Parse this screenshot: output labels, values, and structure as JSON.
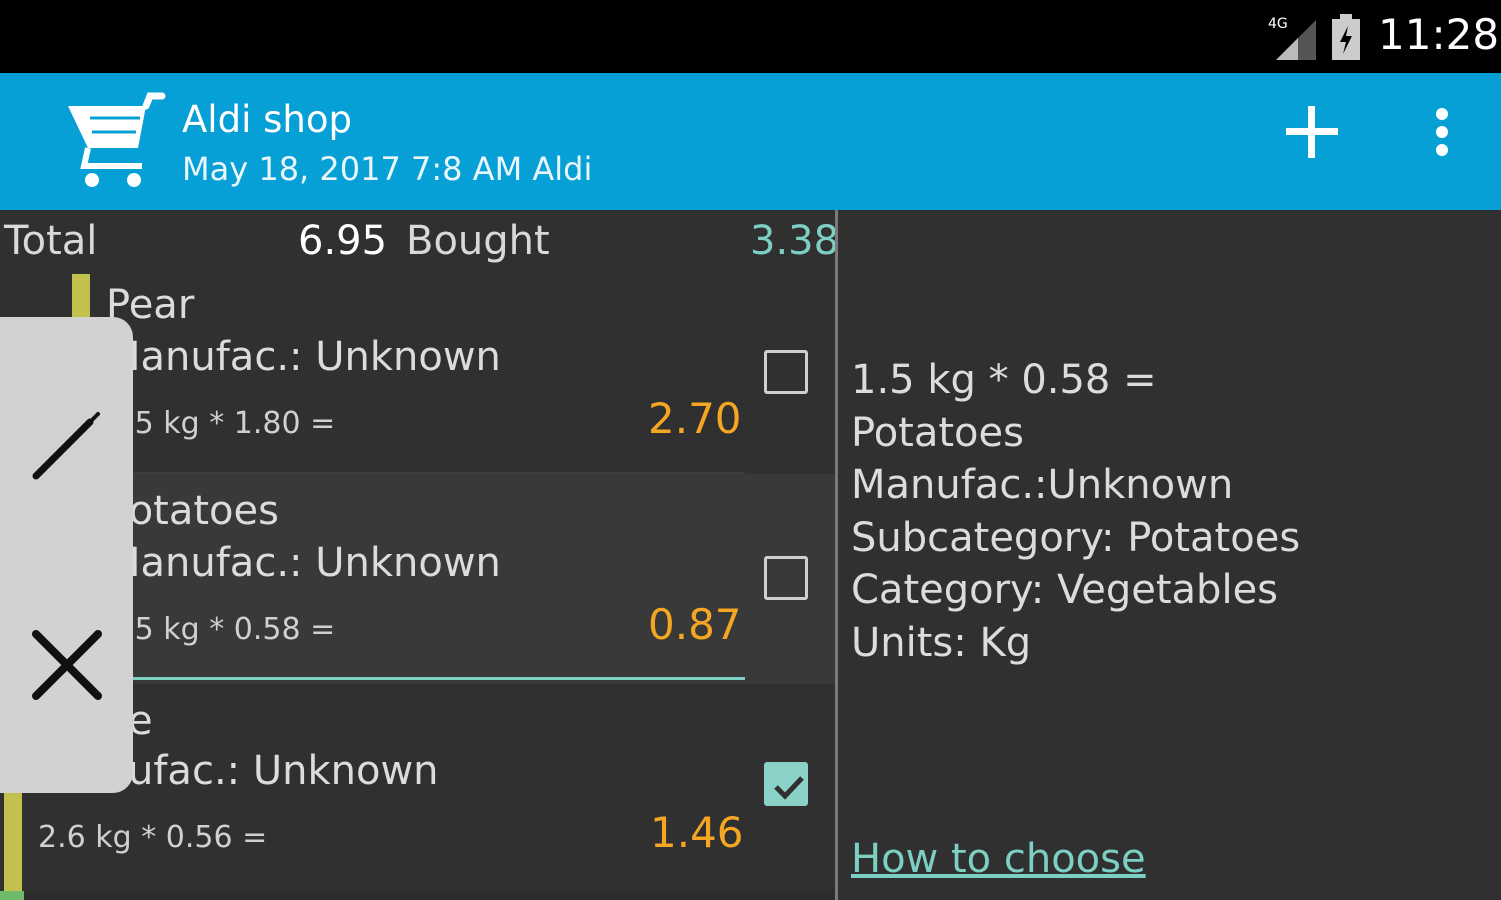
{
  "status_bar": {
    "time": "11:28",
    "network": "4G"
  },
  "app_bar": {
    "title": "Aldi shop",
    "subtitle": "May 18, 2017 7:8 AM Aldi",
    "icons": [
      "cart-icon",
      "add-icon",
      "more-vert-icon"
    ],
    "color": "#06a0d6"
  },
  "summary": {
    "total_label": "Total",
    "total_value": "6.95",
    "bought_label": "Bought",
    "bought_value": "3.38"
  },
  "items": [
    {
      "name": "Pear",
      "manufacturer": "Manufac.: Unknown",
      "formula": "1.5 kg * 1.80 =",
      "price": "2.70",
      "checked": false
    },
    {
      "name": "Potatoes",
      "manufacturer": "Manufac.: Unknown",
      "formula": "1.5 kg * 0.58 =",
      "price": "0.87",
      "checked": false
    },
    {
      "name": "e",
      "manufacturer": "ufac.: Unknown",
      "formula": "2.6 kg * 0.56 =",
      "price": "1.46",
      "checked": true
    }
  ],
  "swipe_actions": {
    "icons": [
      "edit-icon",
      "delete-icon"
    ]
  },
  "detail": {
    "line1": "1.5 kg * 0.58 =",
    "line2": "Potatoes",
    "line3": "Manufac.:Unknown",
    "line4": "Subcategory: Potatoes",
    "line5": "Category: Vegetables",
    "line6": "Units: Kg",
    "link": "How to choose"
  },
  "colors": {
    "price": "#f5a623",
    "accent": "#7ccfc3",
    "stripe": "#c2c14e"
  }
}
